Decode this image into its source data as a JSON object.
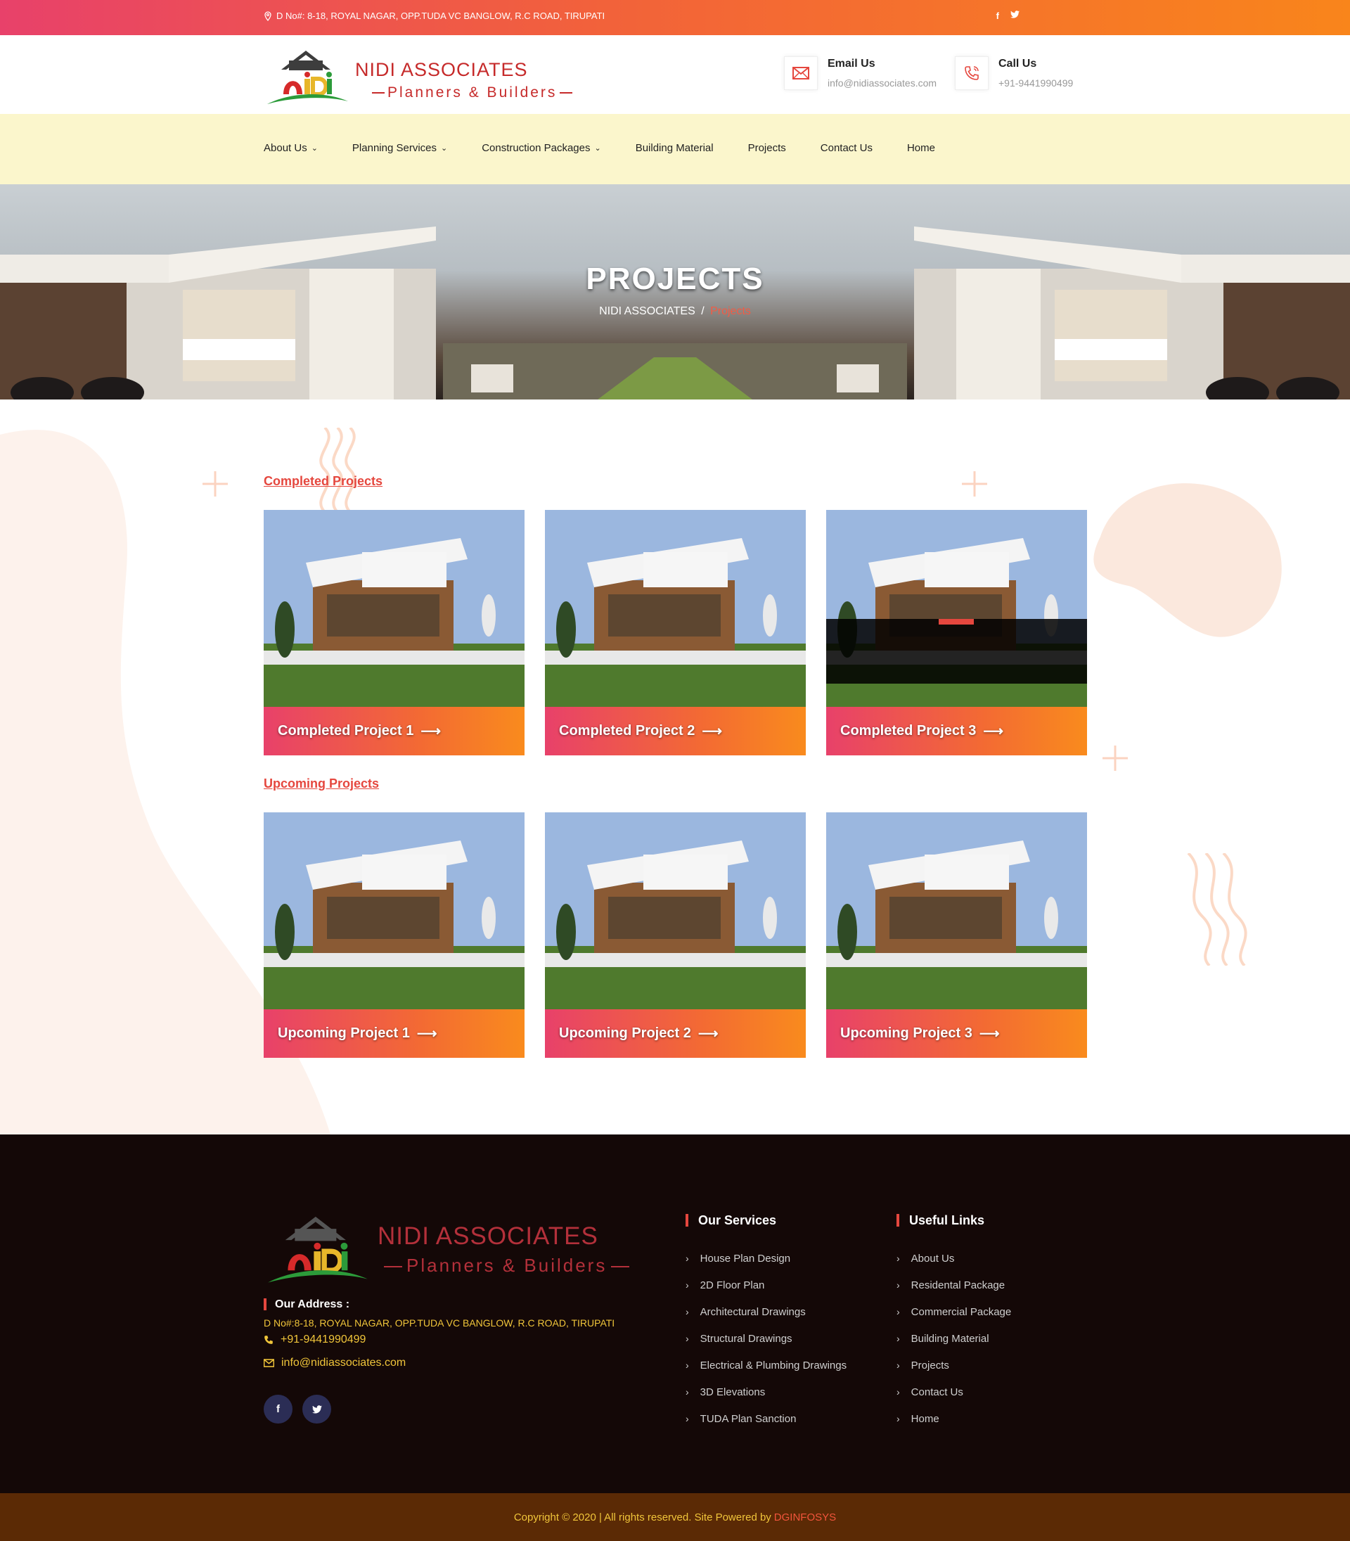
{
  "topbar": {
    "address": "D No#: 8-18, ROYAL NAGAR, OPP.TUDA VC BANGLOW, R.C ROAD, TIRUPATI",
    "facebook": "f",
    "twitter": "t"
  },
  "header": {
    "brand_name": "NIDI ASSOCIATES",
    "brand_tagline": "Planners & Builders",
    "email_label": "Email Us",
    "email_value": "info@nidiassociates.com",
    "call_label": "Call Us",
    "call_value": "+91-9441990499"
  },
  "nav": {
    "items": [
      {
        "label": "About Us",
        "dropdown": "⌄"
      },
      {
        "label": "Planning Services",
        "dropdown": "⌄"
      },
      {
        "label": "Construction Packages",
        "dropdown": "⌄"
      },
      {
        "label": "Building Material",
        "dropdown": ""
      },
      {
        "label": "Projects",
        "dropdown": ""
      },
      {
        "label": "Contact Us",
        "dropdown": ""
      },
      {
        "label": "Home",
        "dropdown": ""
      }
    ]
  },
  "hero": {
    "title": "PROJECTS",
    "crumb_home": "NIDI ASSOCIATES",
    "crumb_sep": "/",
    "crumb_current": "Projects"
  },
  "main": {
    "completed_label": "Completed Projects",
    "upcoming_label": "Upcoming Projects",
    "completed": [
      {
        "title": "Completed Project 1"
      },
      {
        "title": "Completed Project 2"
      },
      {
        "title": "Completed Project 3"
      }
    ],
    "upcoming": [
      {
        "title": "Upcoming Project 1"
      },
      {
        "title": "Upcoming Project 2"
      },
      {
        "title": "Upcoming Project 3"
      }
    ],
    "arrow": "⟶"
  },
  "footer": {
    "brand_name": "NIDI ASSOCIATES",
    "brand_tagline": "Planners & Builders",
    "address_heading": "Our Address :",
    "address": "D No#:8-18, ROYAL NAGAR, OPP.TUDA VC BANGLOW, R.C ROAD, TIRUPATI",
    "phone": "+91-9441990499",
    "email": "info@nidiassociates.com",
    "services_heading": "Our Services",
    "services": [
      "House Plan Design",
      "2D Floor Plan",
      "Architectural Drawings",
      "Structural Drawings",
      "Electrical & Plumbing Drawings",
      "3D Elevations",
      "TUDA Plan Sanction"
    ],
    "links_heading": "Useful Links",
    "links": [
      "About Us",
      "Residental Package",
      "Commercial Package",
      "Building Material",
      "Projects",
      "Contact Us",
      "Home"
    ],
    "facebook": "f",
    "twitter": "t",
    "copyright": "Copyright © 2020 | All rights reserved. Site Powered by",
    "powered_by": "DGINFOSYS"
  },
  "colors": {
    "accent": "#e5473e",
    "gradient_start": "#e8416a",
    "gradient_end": "#f98b1d",
    "nav_bg": "#fbf6cc",
    "footer_bg": "#140807",
    "copyright_bg": "#5b2a05",
    "footer_highlight": "#f0c53a"
  }
}
